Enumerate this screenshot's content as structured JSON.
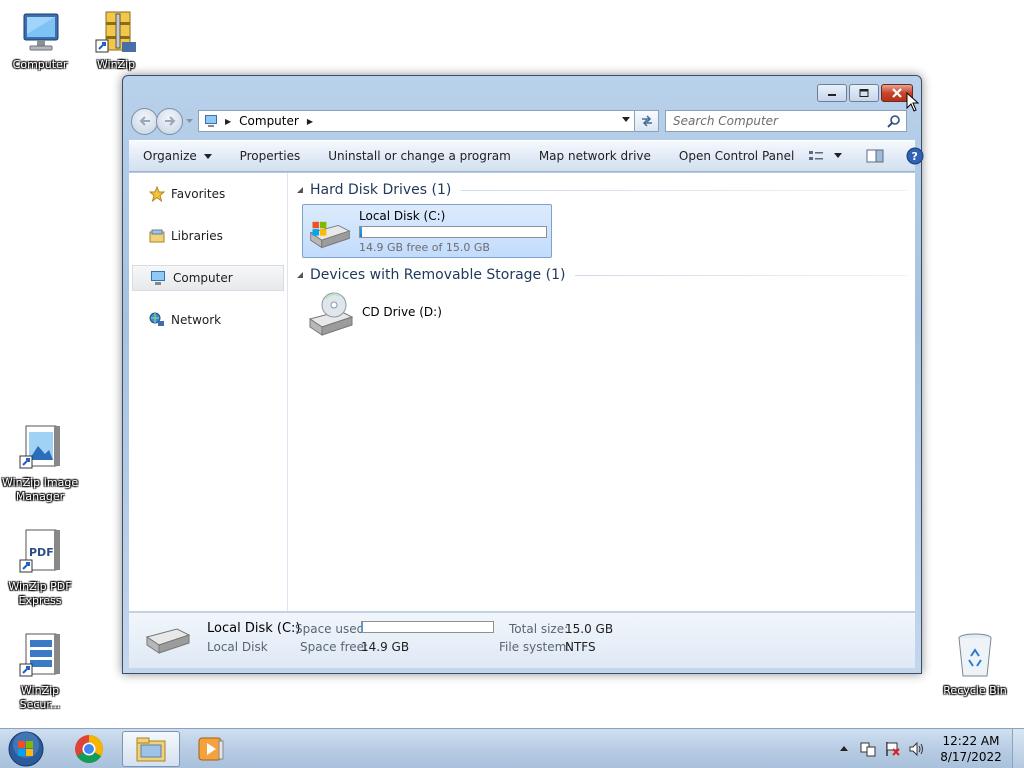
{
  "desktop": {
    "icons": [
      {
        "label": "Computer"
      },
      {
        "label": "WinZip"
      },
      {
        "label": "WinZip Image Manager"
      },
      {
        "label": "WinZip PDF Express"
      },
      {
        "label": "WinZip Secur..."
      },
      {
        "label": "Recycle Bin"
      }
    ]
  },
  "window": {
    "address": {
      "crumbs": [
        "Computer"
      ],
      "search_placeholder": "Search Computer"
    },
    "toolbar": {
      "organize": "Organize",
      "properties": "Properties",
      "uninstall": "Uninstall or change a program",
      "map_drive": "Map network drive",
      "control_panel": "Open Control Panel"
    },
    "nav": {
      "items": [
        {
          "label": "Favorites",
          "icon": "star-icon"
        },
        {
          "label": "Libraries",
          "icon": "libraries-icon"
        },
        {
          "label": "Computer",
          "icon": "computer-icon",
          "selected": true
        },
        {
          "label": "Network",
          "icon": "network-icon"
        }
      ]
    },
    "groups": [
      {
        "title": "Hard Disk Drives (1)",
        "items": [
          {
            "name": "Local Disk (C:)",
            "free_text": "14.9 GB free of 15.0 GB",
            "used_fraction": 0.007
          }
        ]
      },
      {
        "title": "Devices with Removable Storage (1)",
        "items": [
          {
            "name": "CD Drive (D:)"
          }
        ]
      }
    ],
    "details": {
      "name": "Local Disk (C:)",
      "type": "Local Disk",
      "space_used_label": "Space used:",
      "space_free_label": "Space free:",
      "space_free_value": "14.9 GB",
      "total_size_label": "Total size:",
      "total_size_value": "15.0 GB",
      "file_system_label": "File system:",
      "file_system_value": "NTFS",
      "used_fraction": 0.007
    }
  },
  "taskbar": {
    "time": "12:22 AM",
    "date": "8/17/2022"
  }
}
